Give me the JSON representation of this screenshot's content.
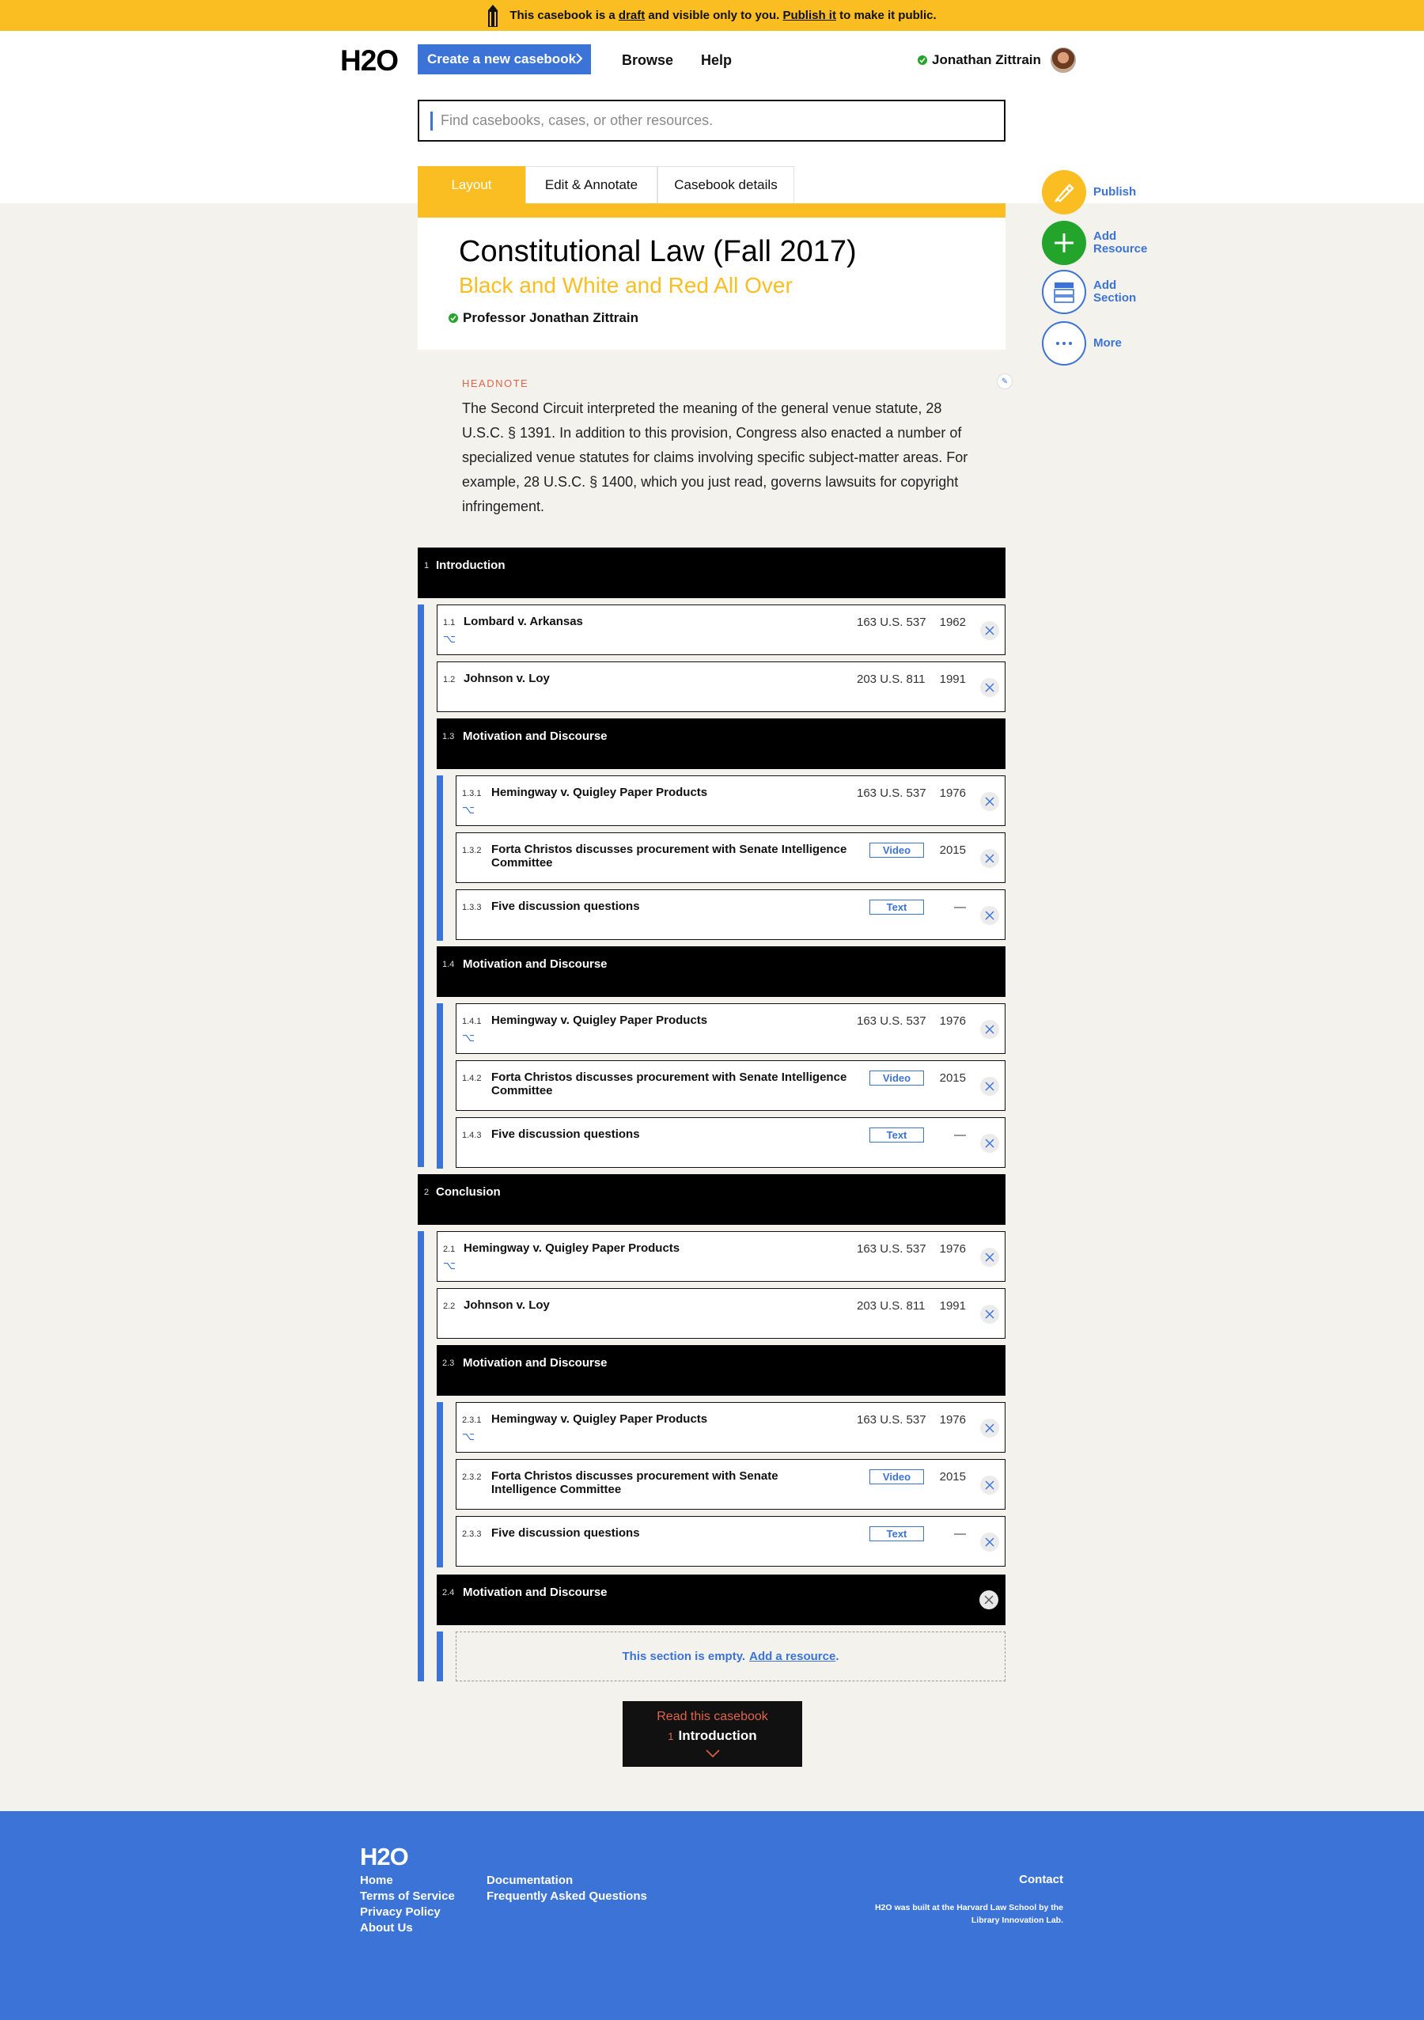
{
  "banner": {
    "prefix": "This casebook is a",
    "draft_link": "draft",
    "middle": "and visible only to you.",
    "publish_link": "Publish it",
    "suffix": "to make it public."
  },
  "header": {
    "logo": "H2O",
    "create_label": "Create a new casebook",
    "browse_label": "Browse",
    "help_label": "Help",
    "user_name": "Jonathan Zittrain"
  },
  "search": {
    "placeholder": "Find casebooks, cases, or other resources.",
    "value": ""
  },
  "tabs": [
    {
      "label": "Layout",
      "active": true
    },
    {
      "label": "Edit & Annotate",
      "active": false
    },
    {
      "label": "Casebook details",
      "active": false
    }
  ],
  "casebook": {
    "title": "Constitutional Law (Fall 2017)",
    "subtitle": "Black and White and Red All Over",
    "author": "Professor Jonathan Zittrain"
  },
  "headnote": {
    "label": "HEADNOTE",
    "text": "The Second Circuit interpreted the meaning of the general venue statute, 28 U.S.C. § 1391. In addition to this provision, Congress also enacted a number of specialized venue statutes for claims involving specific subject-matter areas. For example, 28 U.S.C. § 1400, which you just read, governs lawsuits for copyright infringement."
  },
  "side_actions": {
    "publish": "Publish",
    "add_resource": [
      "Add",
      "Resource"
    ],
    "add_section": [
      "Add",
      "Section"
    ],
    "more": "More"
  },
  "toc": {
    "s1": {
      "num": "1",
      "title": "Introduction"
    },
    "r1_1": {
      "num": "1.1",
      "title": "Lombard v. Arkansas",
      "cite": "163 U.S. 537",
      "year": "1962"
    },
    "r1_2": {
      "num": "1.2",
      "title": "Johnson v. Loy",
      "cite": "203 U.S. 811",
      "year": "1991"
    },
    "s1_3": {
      "num": "1.3",
      "title": "Motivation and Discourse"
    },
    "r1_3_1": {
      "num": "1.3.1",
      "title": "Hemingway v. Quigley Paper Products",
      "cite": "163 U.S. 537",
      "year": "1976"
    },
    "r1_3_2": {
      "num": "1.3.2",
      "title": "Forta Christos discusses procurement with Senate Intelligence Committee",
      "tag": "Video",
      "year": "2015"
    },
    "r1_3_3": {
      "num": "1.3.3",
      "title": "Five discussion questions",
      "tag": "Text",
      "year": "—"
    },
    "s1_4": {
      "num": "1.4",
      "title": "Motivation and Discourse"
    },
    "r1_4_1": {
      "num": "1.4.1",
      "title": "Hemingway v. Quigley Paper Products",
      "cite": "163 U.S. 537",
      "year": "1976"
    },
    "r1_4_2": {
      "num": "1.4.2",
      "title": "Forta Christos discusses procurement with Senate Intelligence Committee",
      "tag": "Video",
      "year": "2015"
    },
    "r1_4_3": {
      "num": "1.4.3",
      "title": "Five discussion questions",
      "tag": "Text",
      "year": "—"
    },
    "s2": {
      "num": "2",
      "title": "Conclusion"
    },
    "r2_1": {
      "num": "2.1",
      "title": "Hemingway v. Quigley Paper Products",
      "cite": "163 U.S. 537",
      "year": "1976"
    },
    "r2_2": {
      "num": "2.2",
      "title": "Johnson v. Loy",
      "cite": "203 U.S. 811",
      "year": "1991"
    },
    "s2_3": {
      "num": "2.3",
      "title": "Motivation and Discourse"
    },
    "r2_3_1": {
      "num": "2.3.1",
      "title": "Hemingway v. Quigley Paper Products",
      "cite": "163 U.S. 537",
      "year": "1976"
    },
    "r2_3_2": {
      "num": "2.3.2",
      "title": "Forta Christos discusses procurement with Senate Intelligence Committee",
      "tag": "Video",
      "year": "2015"
    },
    "r2_3_3": {
      "num": "2.3.3",
      "title": "Five discussion questions",
      "tag": "Text",
      "year": "—"
    },
    "s2_4": {
      "num": "2.4",
      "title": "Motivation and Discourse"
    },
    "empty": {
      "text": "This section is empty.",
      "link": "Add a resource",
      "end": "."
    }
  },
  "read_button": {
    "label": "Read this casebook",
    "num": "1",
    "title": "Introduction"
  },
  "footer": {
    "logo": "H2O",
    "col1": [
      "Home",
      "Terms of Service",
      "Privacy Policy",
      "About Us"
    ],
    "col2": [
      "Documentation",
      "Frequently Asked Questions"
    ],
    "contact": "Contact",
    "built_line1": "H2O was built at the Harvard Law School by the",
    "built_line2": "Library Innovation Lab."
  },
  "colors": {
    "yellow": "#fbbe22",
    "blue": "#3c73d6",
    "green": "#22a52a",
    "black": "#000000",
    "grey_bg": "#f3f2ec",
    "salmon": "#e0644a"
  },
  "icons": {
    "banner": "pencil-icon",
    "verified": "check-circle-icon",
    "publish": "pen-icon",
    "add_resource": "plus-icon",
    "add_section": "section-stack-icon",
    "more": "ellipsis-icon",
    "remove": "close-icon",
    "annotations": "annotation-icon",
    "read_arrow": "chevron-down-icon"
  }
}
